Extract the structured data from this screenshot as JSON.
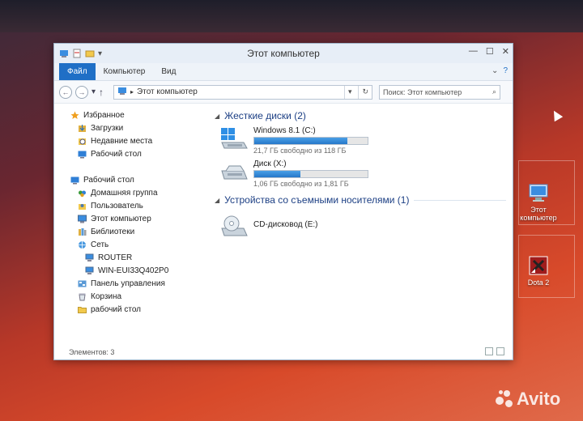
{
  "window": {
    "title": "Этот компьютер",
    "ribbon_tabs": [
      "Файл",
      "Компьютер",
      "Вид"
    ]
  },
  "address_bar": {
    "path": "Этот компьютер",
    "search_placeholder": "Поиск: Этот компьютер"
  },
  "nav": {
    "items": [
      {
        "label": "Избранное",
        "icon": "star-icon",
        "indent": 0,
        "gap": false
      },
      {
        "label": "Загрузки",
        "icon": "downloads-icon",
        "indent": 1,
        "gap": false
      },
      {
        "label": "Недавние места",
        "icon": "recent-places-icon",
        "indent": 1,
        "gap": false
      },
      {
        "label": "Рабочий стол",
        "icon": "desktop-icon",
        "indent": 1,
        "gap": false
      },
      {
        "label": "Рабочий стол",
        "icon": "desktop-icon",
        "indent": 0,
        "gap": true
      },
      {
        "label": "Домашняя группа",
        "icon": "homegroup-icon",
        "indent": 1,
        "gap": false
      },
      {
        "label": "Пользователь",
        "icon": "user-folder-icon",
        "indent": 1,
        "gap": false
      },
      {
        "label": "Этот компьютер",
        "icon": "computer-icon",
        "indent": 1,
        "gap": false
      },
      {
        "label": "Библиотеки",
        "icon": "libraries-icon",
        "indent": 1,
        "gap": false
      },
      {
        "label": "Сеть",
        "icon": "network-icon",
        "indent": 1,
        "gap": false
      },
      {
        "label": "ROUTER",
        "icon": "network-computer-icon",
        "indent": 2,
        "gap": false
      },
      {
        "label": "WIN-EUI33Q402P0",
        "icon": "network-computer-icon",
        "indent": 2,
        "gap": false
      },
      {
        "label": "Панель управления",
        "icon": "control-panel-icon",
        "indent": 1,
        "gap": false
      },
      {
        "label": "Корзина",
        "icon": "recycle-bin-icon",
        "indent": 1,
        "gap": false
      },
      {
        "label": "рабочий стол",
        "icon": "folder-icon",
        "indent": 1,
        "gap": false
      }
    ]
  },
  "content": {
    "group_hdd": "Жесткие диски (2)",
    "group_removable": "Устройства со съемными носителями (1)",
    "drives": [
      {
        "name": "Windows 8.1 (C:)",
        "free_text": "21,7 ГБ свободно из 118 ГБ",
        "used_fraction": 0.82
      },
      {
        "name": "Диск (X:)",
        "free_text": "1,06 ГБ свободно из 1,81 ГБ",
        "used_fraction": 0.41
      }
    ],
    "cd_name": "CD-дисковод (E:)"
  },
  "status": {
    "text": "Элементов: 3"
  },
  "desktop": {
    "icon1_line1": "Этот",
    "icon1_line2": "компьютер",
    "icon2": "Dota 2"
  },
  "watermark": "Avito",
  "colors": {
    "accent": "#1f6fc6",
    "group_header": "#1c3f84",
    "bar_fill": "#2677c9"
  }
}
